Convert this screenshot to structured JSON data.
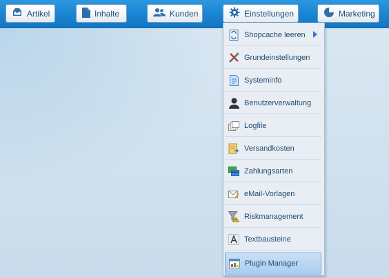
{
  "nav": {
    "items": [
      {
        "label": "Artikel",
        "icon": "tray-icon"
      },
      {
        "label": "Inhalte",
        "icon": "document-icon"
      },
      {
        "label": "Kunden",
        "icon": "users-icon"
      },
      {
        "label": "Einstellungen",
        "icon": "gear-icon"
      },
      {
        "label": "Marketing",
        "icon": "pie-chart-icon"
      }
    ]
  },
  "menu": {
    "items": [
      {
        "label": "Shopcache leeren",
        "icon": "cache-icon",
        "has_submenu": true
      },
      {
        "label": "Grundeinstellungen",
        "icon": "tools-icon"
      },
      {
        "label": "Systeminfo",
        "icon": "info-document-icon"
      },
      {
        "label": "Benutzerverwaltung",
        "icon": "user-silhouette-icon"
      },
      {
        "label": "Logfile",
        "icon": "log-pages-icon"
      },
      {
        "label": "Versandkosten",
        "icon": "shipping-icon"
      },
      {
        "label": "Zahlungsarten",
        "icon": "payment-cards-icon"
      },
      {
        "label": "eMail-Vorlagen",
        "icon": "email-template-icon"
      },
      {
        "label": "Riskmanagement",
        "icon": "risk-filter-icon"
      },
      {
        "label": "Textbausteine",
        "icon": "text-blocks-icon"
      },
      {
        "label": "Plugin Manager",
        "icon": "plugin-manager-icon",
        "selected": true
      }
    ]
  },
  "colors": {
    "topbar": "#1a85d2",
    "menu_background": "#e8eef3",
    "menu_text": "#244c72",
    "selected_item": "#aacdee"
  }
}
